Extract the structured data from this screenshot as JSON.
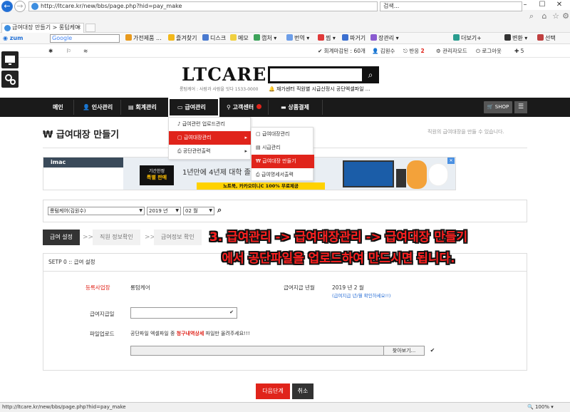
{
  "browser": {
    "url": "http://ltcare.kr/new/bbs/page.php?hid=pay_make",
    "search_placeholder": "검색...",
    "tab_title": "급여대장 만들기 > 롱텀케어",
    "google_label": "Google",
    "zum_label": "zum",
    "favorites": [
      "가전제품 ...",
      "즐겨찾기",
      "디스크",
      "메모",
      "캡처",
      "번역",
      "찜",
      "파거기",
      "장관리",
      "더보기+",
      "변환",
      "선택"
    ],
    "status_url": "http://ltcare.kr/new/bbs/page.php?hid=pay_make",
    "zoom": "100%"
  },
  "topbar": {
    "deadline": "회계마감된 : 60개",
    "user": "김원수",
    "reply_label": "반응",
    "reply_count": "2",
    "admin_mode": "관리자모드",
    "logout": "로그아웃",
    "count": "5"
  },
  "header": {
    "logo": "LTCARE",
    "subtitle": "롱텀케어 : 사람과 사람을 잇다 1533-0000",
    "notice": "재가센터 직원별 시급산정시 공단엑셀파일 ..."
  },
  "nav": {
    "items": [
      "메인",
      "인사관리",
      "회계관리",
      "급여관리",
      "고객센터",
      "상품결제"
    ],
    "shop": "SHOP"
  },
  "dropdown1": [
    {
      "label": "급여관련 업로드관리"
    },
    {
      "label": "급여대장관리"
    },
    {
      "label": "공단관련출력"
    }
  ],
  "dropdown2": [
    {
      "label": "급여대장관리"
    },
    {
      "label": "시급관리"
    },
    {
      "label": "급여대장 만들기"
    },
    {
      "label": "급여명세서출력"
    }
  ],
  "page": {
    "title": "₩ 급여대장 만들기",
    "desc": "직원의 급여대장을 만들 수 있습니다."
  },
  "banner": {
    "brand": "imac",
    "badge_top": "기간한정",
    "badge_bottom": "특별 판매",
    "headline": "1년만에 4년제 대학 졸업",
    "promo": "노트북, 카카오미니C 100% 무료제공"
  },
  "filter": {
    "company": "롱텀케어(김원수)",
    "year": "2019 년",
    "month": "02 월"
  },
  "steps": [
    "급여 설정",
    "직원 정보확인",
    "급여정보 확인"
  ],
  "form": {
    "section_title": "SETP 0 :: 급여 설정",
    "org_label": "등록사업장",
    "org_value": "롱텀케어",
    "pay_month_label": "급여지급 년월",
    "pay_month_value": "2019 년 2 월",
    "pay_month_hint": "(급여지급 년/월 확인하세요!!)",
    "pay_day_label": "급여지급일",
    "upload_label": "파일업로드",
    "upload_hint_a": "공단파일 엑셀파일 중 ",
    "upload_hint_b": "청구내역상세",
    "upload_hint_c": " 파일만 올려주세요!!!",
    "browse": "찾아보기..."
  },
  "buttons": {
    "next": "다음단계",
    "cancel": "취소"
  },
  "annotation": {
    "line1": "3. 급여관리 -> 급여대장관리 -> 급여대장 만들기",
    "line2": "에서 공단파일을 업로드하여 만드시면 됩니다."
  }
}
